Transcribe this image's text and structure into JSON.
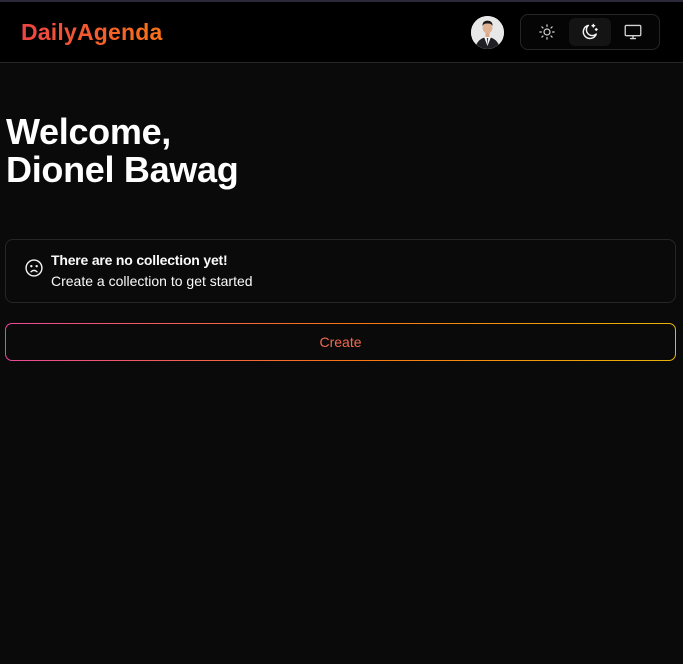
{
  "app": {
    "name": "DailyAgenda"
  },
  "header": {
    "avatar_alt": "User avatar",
    "theme": {
      "options": [
        "light",
        "dark",
        "system"
      ],
      "selected": "dark"
    }
  },
  "main": {
    "greeting_line1": "Welcome,",
    "greeting_line2": "Dionel Bawag",
    "empty_state": {
      "title": "There are no collection yet!",
      "description": "Create a collection to get started"
    },
    "create_button_label": "Create"
  },
  "colors": {
    "background": "#0a0a0a",
    "navbar": "#000000",
    "border": "#262626",
    "logo_gradient": [
      "#ef4444",
      "#f97316"
    ],
    "button_gradient": [
      "#ec4899",
      "#f97316",
      "#eab308"
    ],
    "button_text": "#f26a4f"
  },
  "icons": {
    "light": "sun-icon",
    "dark": "moon-stars-icon",
    "system": "desktop-icon",
    "empty_state": "frown-face-icon"
  }
}
